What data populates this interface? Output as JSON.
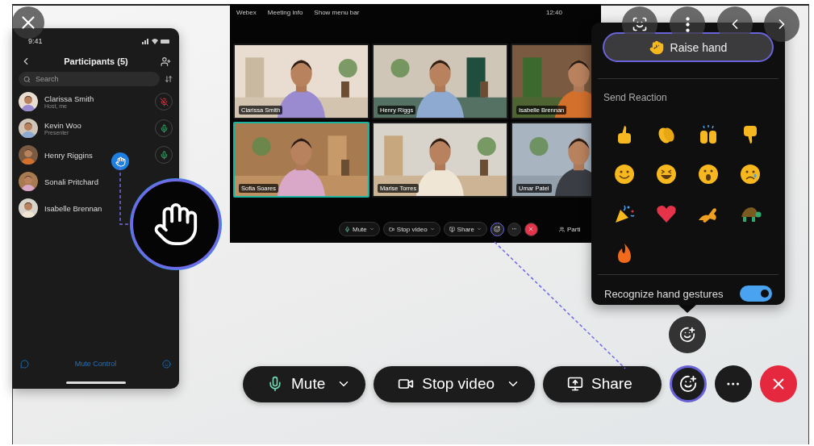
{
  "phone": {
    "time": "9:41",
    "title": "Participants (5)",
    "search": {
      "placeholder": "Search"
    },
    "participants": [
      {
        "name": "Clarissa Smith",
        "role": "Host, me",
        "muted": true,
        "hand_raised": false
      },
      {
        "name": "Kevin Woo",
        "role": "Presenter",
        "muted": false,
        "hand_raised": false
      },
      {
        "name": "Henry Riggins",
        "muted": false,
        "hand_raised": true
      },
      {
        "name": "Sonali Pritchard",
        "hand_raised": false
      },
      {
        "name": "Isabelle Brennan",
        "hand_raised": false
      }
    ],
    "footer": "Mute Control"
  },
  "meeting_window": {
    "menu": [
      "Webex",
      "Meeting info",
      "Show menu bar"
    ],
    "time": "12:40",
    "tiles": [
      {
        "name": "Clarissa Smith",
        "speaking": false
      },
      {
        "name": "Henry Riggs",
        "speaking": false
      },
      {
        "name": "Isabelle Brennan",
        "speaking": false
      },
      {
        "name": "Sofia Soares",
        "speaking": true
      },
      {
        "name": "Marise Torres",
        "speaking": false
      },
      {
        "name": "Umar Patel",
        "speaking": false
      }
    ],
    "controls": [
      {
        "kind": "mute",
        "label": "Mute"
      },
      {
        "kind": "video",
        "label": "Stop video"
      },
      {
        "kind": "share",
        "label": "Share"
      },
      {
        "kind": "reactions"
      },
      {
        "kind": "more"
      },
      {
        "kind": "leave"
      }
    ],
    "participants_label": "Parti"
  },
  "reactions_popover": {
    "raise_hand": "Raise hand",
    "heading": "Send Reaction",
    "gesture_toggle": {
      "label": "Recognize hand gestures",
      "on": true
    }
  },
  "toolbar": [
    {
      "kind": "mute",
      "label": "Mute"
    },
    {
      "kind": "video",
      "label": "Stop video"
    },
    {
      "kind": "share",
      "label": "Share"
    },
    {
      "kind": "reactions"
    },
    {
      "kind": "more"
    },
    {
      "kind": "leave"
    }
  ]
}
